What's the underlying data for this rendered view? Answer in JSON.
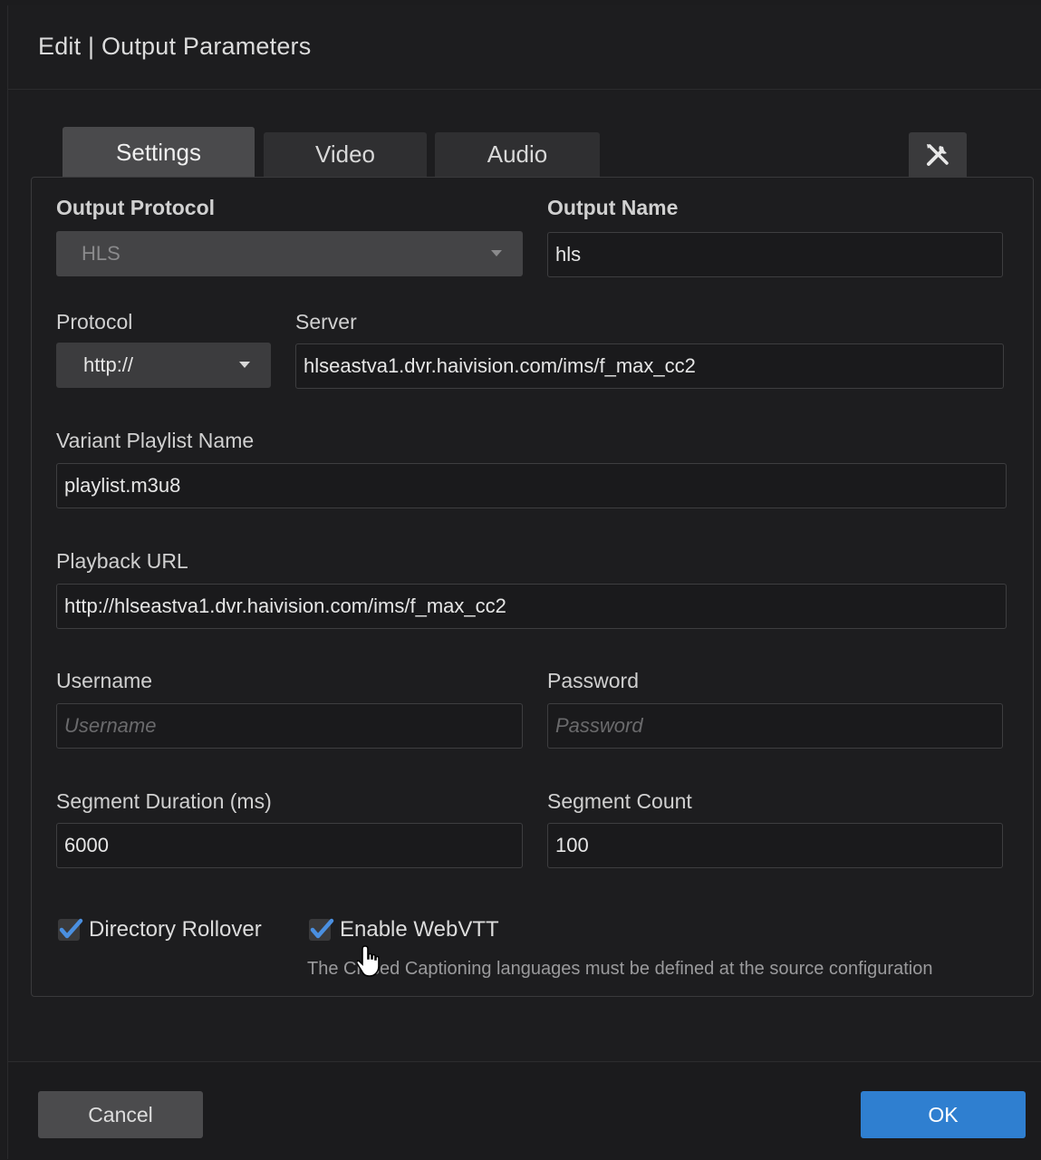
{
  "dialog": {
    "title": "Edit | Output Parameters"
  },
  "tabs": [
    {
      "label": "Settings",
      "active": true
    },
    {
      "label": "Video",
      "active": false
    },
    {
      "label": "Audio",
      "active": false
    }
  ],
  "tools_icon": "tools-icon",
  "form": {
    "output_protocol": {
      "label": "Output Protocol",
      "value": "HLS"
    },
    "output_name": {
      "label": "Output Name",
      "value": "hls"
    },
    "protocol": {
      "label": "Protocol",
      "value": "http://"
    },
    "server": {
      "label": "Server",
      "value": "hlseastva1.dvr.haivision.com/ims/f_max_cc2"
    },
    "variant_playlist": {
      "label": "Variant Playlist Name",
      "value": "playlist.m3u8"
    },
    "playback_url": {
      "label": "Playback URL",
      "value": "http://hlseastva1.dvr.haivision.com/ims/f_max_cc2"
    },
    "username": {
      "label": "Username",
      "placeholder": "Username"
    },
    "password": {
      "label": "Password",
      "placeholder": "Password"
    },
    "segment_duration": {
      "label": "Segment Duration (ms)",
      "value": "6000"
    },
    "segment_count": {
      "label": "Segment Count",
      "value": "100"
    },
    "directory_rollover": {
      "label": "Directory Rollover",
      "checked": true
    },
    "enable_webvtt": {
      "label": "Enable WebVTT",
      "checked": true
    },
    "webvtt_help": "The Closed Captioning languages must be defined at the source configuration"
  },
  "footer": {
    "cancel_label": "Cancel",
    "ok_label": "OK"
  },
  "colors": {
    "accent": "#2f7fd0",
    "checkmark": "#4a8fe0",
    "background": "#1d1d1f"
  }
}
